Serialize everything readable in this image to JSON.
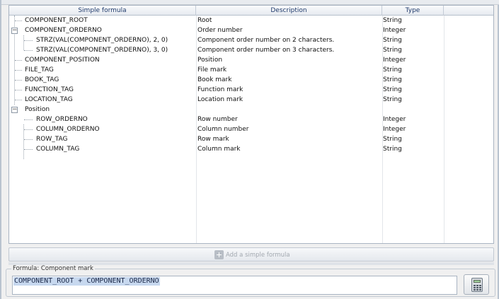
{
  "grid": {
    "columns": [
      "Simple formula",
      "Description",
      "Type"
    ],
    "rows": [
      {
        "formula": "COMPONENT_ROOT",
        "description": "Root",
        "type": "String"
      },
      {
        "formula": "COMPONENT_ORDERNO",
        "description": "Order number",
        "type": "Integer"
      },
      {
        "formula": "STRZ(VAL(COMPONENT_ORDERNO), 2, 0)",
        "description": "Component order number on 2 characters.",
        "type": "String"
      },
      {
        "formula": "STRZ(VAL(COMPONENT_ORDERNO), 3, 0)",
        "description": "Component order number on 3 characters.",
        "type": "String"
      },
      {
        "formula": "COMPONENT_POSITION",
        "description": "Position",
        "type": "Integer"
      },
      {
        "formula": "FILE_TAG",
        "description": "File mark",
        "type": "String"
      },
      {
        "formula": "BOOK_TAG",
        "description": "Book mark",
        "type": "String"
      },
      {
        "formula": "FUNCTION_TAG",
        "description": "Function mark",
        "type": "String"
      },
      {
        "formula": "LOCATION_TAG",
        "description": "Location mark",
        "type": "String"
      },
      {
        "formula": "Position",
        "description": "",
        "type": ""
      },
      {
        "formula": "ROW_ORDERNO",
        "description": "Row number",
        "type": "Integer"
      },
      {
        "formula": "COLUMN_ORDERNO",
        "description": "Column number",
        "type": "Integer"
      },
      {
        "formula": "ROW_TAG",
        "description": "Row mark",
        "type": "String"
      },
      {
        "formula": "COLUMN_TAG",
        "description": "Column mark",
        "type": "String"
      }
    ]
  },
  "add_button": {
    "label": "Add a simple formula",
    "icon": "plus-icon"
  },
  "formula": {
    "legend": "Formula: Component mark",
    "value": "COMPONENT_ROOT + COMPONENT_ORDERNO",
    "button_icon": "calculator-icon"
  }
}
